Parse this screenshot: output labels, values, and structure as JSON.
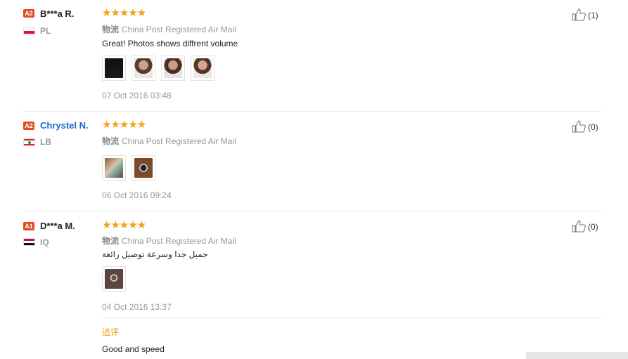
{
  "reviews": [
    {
      "level": "A2",
      "name": "B***a R.",
      "country": "PL",
      "stars": "★★★★★",
      "logistics_label": "物流",
      "logistics": "China Post Registered Air Mail",
      "text": "Great! Photos shows diffrent volume",
      "date": "07 Oct 2016 03:48",
      "useful": "(1)",
      "photos": [
        "buyer-photo-1",
        "buyer-photo-2",
        "buyer-photo-3",
        "buyer-photo-4"
      ]
    },
    {
      "level": "A2",
      "name": "Chrystel N.",
      "country": "LB",
      "stars": "★★★★★",
      "logistics_label": "物流",
      "logistics": "China Post Registered Air Mail",
      "text": "",
      "date": "06 Oct 2016 09:24",
      "useful": "(0)",
      "photos": [
        "buyer-photo-1",
        "buyer-photo-2"
      ]
    },
    {
      "level": "A1",
      "name": "D***a M.",
      "country": "IQ",
      "stars": "★★★★★",
      "logistics_label": "物流",
      "logistics": "China Post Registered Air Mail",
      "text": "جميل جدا وسرعة توصيل رائعة",
      "date": "04 Oct 2016 13:37",
      "useful": "(0)",
      "photos": [
        "buyer-photo-1"
      ],
      "append_label": "追评",
      "append_text": "Good and speed"
    }
  ],
  "colors": {
    "star": "#f4a01c",
    "level_badge": "#e34b1f",
    "name_link": "#1a68c9",
    "append_label": "#e89a1a"
  },
  "icons": {
    "useful": "thumbs-up-icon"
  }
}
